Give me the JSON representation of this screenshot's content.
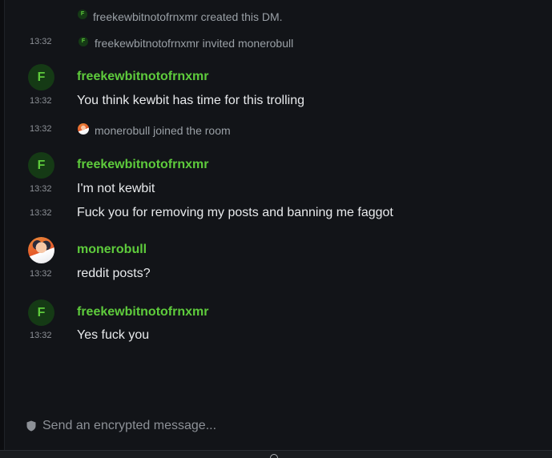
{
  "timeline": {
    "events": [
      {
        "timestamp": "",
        "avatar_letter": "F",
        "text": "freekewbitnotofrnxmr created this DM."
      },
      {
        "timestamp": "13:32",
        "avatar_letter": "F",
        "text": "freekewbitnotofrnxmr invited monerobull"
      },
      {
        "timestamp": "13:32",
        "text": "monerobull joined the room"
      }
    ],
    "messages": [
      {
        "sender": "freekewbitnotofrnxmr",
        "avatar_letter": "F",
        "lines": [
          {
            "timestamp": "13:32",
            "text": "You think kewbit has time for this trolling"
          }
        ]
      },
      {
        "sender": "freekewbitnotofrnxmr",
        "avatar_letter": "F",
        "lines": [
          {
            "timestamp": "13:32",
            "text": "I'm not kewbit"
          },
          {
            "timestamp": "13:32",
            "text": "Fuck you for removing my posts and banning me faggot"
          }
        ]
      },
      {
        "sender": "monerobull",
        "lines": [
          {
            "timestamp": "13:32",
            "text": "reddit posts?"
          }
        ]
      },
      {
        "sender": "freekewbitnotofrnxmr",
        "avatar_letter": "F",
        "lines": [
          {
            "timestamp": "13:32",
            "text": "Yes fuck you"
          }
        ]
      }
    ]
  },
  "composer": {
    "placeholder": "Send an encrypted message...",
    "value": "",
    "icon": "shield-icon"
  },
  "colors": {
    "background": "#121418",
    "sender_name": "#5ecb3c",
    "avatar_bg": "#153a15",
    "muted_text": "#9aa0a6",
    "body_text": "#e8eaec"
  }
}
